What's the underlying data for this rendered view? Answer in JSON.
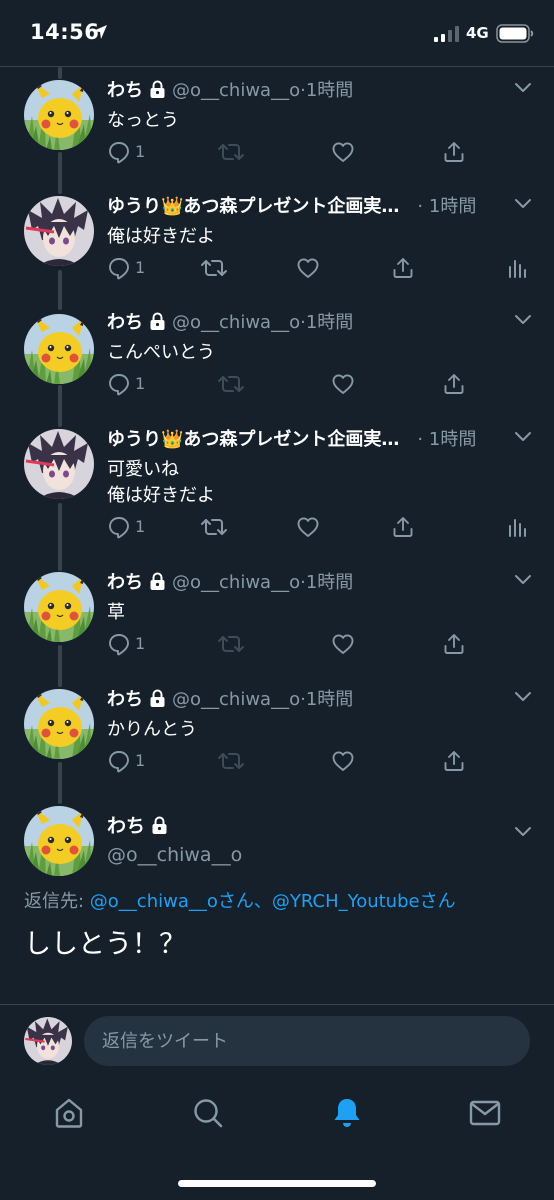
{
  "status_bar": {
    "time": "14:56",
    "network": "4G",
    "icons": [
      "location-arrow-icon",
      "signal-bars-icon",
      "battery-icon"
    ]
  },
  "thread": [
    {
      "name": "わち",
      "handle": "@o__chiwa__o",
      "time": "·1時間",
      "protected": true,
      "text": "なっとう",
      "reply_count": "1",
      "avatar": "pikachu"
    },
    {
      "name": "ゆうり👑あつ森プレゼント企画実…",
      "time": "· 1時間",
      "protected": false,
      "text": "俺は好きだよ",
      "reply_count": "1",
      "avatar": "anime-character"
    },
    {
      "name": "わち",
      "handle": "@o__chiwa__o",
      "time": "·1時間",
      "protected": true,
      "text": "こんぺいとう",
      "reply_count": "1",
      "avatar": "pikachu"
    },
    {
      "name": "ゆうり👑あつ森プレゼント企画実…",
      "time": "· 1時間",
      "protected": false,
      "text_line1": "可愛いね",
      "text_line2": "俺は好きだよ",
      "reply_count": "1",
      "avatar": "anime-character"
    },
    {
      "name": "わち",
      "handle": "@o__chiwa__o",
      "time": "·1時間",
      "protected": true,
      "text": "草",
      "reply_count": "1",
      "avatar": "pikachu"
    },
    {
      "name": "わち",
      "handle": "@o__chiwa__o",
      "time": "·1時間",
      "protected": true,
      "text": "かりんとう",
      "reply_count": "1",
      "avatar": "pikachu"
    }
  ],
  "main_tweet": {
    "name": "わち",
    "handle": "@o__chiwa__o",
    "reply_prefix": "返信先: ",
    "mention1": "@o__chiwa__oさん",
    "separator": "、",
    "mention2": "@YRCH_Youtubeさん",
    "text": "ししとう！？"
  },
  "compose": {
    "placeholder": "返信をツイート"
  },
  "tab_bar": {
    "tabs": [
      "home-icon",
      "search-icon",
      "notifications-icon",
      "messages-icon"
    ],
    "active": "notifications-icon"
  },
  "colors": {
    "background": "#15202b",
    "accent": "#1da1f2",
    "secondary_text": "#8899a6",
    "divider": "#38444d"
  }
}
